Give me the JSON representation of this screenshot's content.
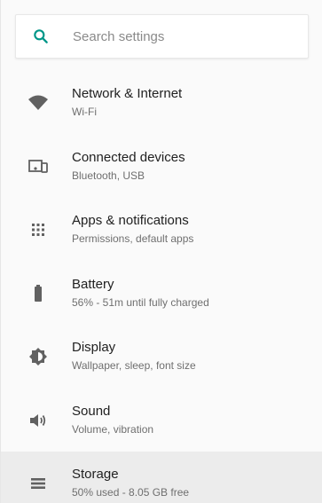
{
  "search": {
    "placeholder": "Search settings"
  },
  "items": [
    {
      "title": "Network & Internet",
      "subtitle": "Wi-Fi",
      "icon": "wifi-icon"
    },
    {
      "title": "Connected devices",
      "subtitle": "Bluetooth, USB",
      "icon": "devices-icon"
    },
    {
      "title": "Apps & notifications",
      "subtitle": "Permissions, default apps",
      "icon": "apps-grid-icon"
    },
    {
      "title": "Battery",
      "subtitle": "56% - 51m until fully charged",
      "icon": "battery-icon"
    },
    {
      "title": "Display",
      "subtitle": "Wallpaper, sleep, font size",
      "icon": "brightness-icon"
    },
    {
      "title": "Sound",
      "subtitle": "Volume, vibration",
      "icon": "volume-icon"
    },
    {
      "title": "Storage",
      "subtitle": "50% used - 8.05 GB free",
      "icon": "storage-icon"
    }
  ],
  "colors": {
    "accent": "#009688",
    "icon": "#616161",
    "active_row": "#ececec"
  }
}
